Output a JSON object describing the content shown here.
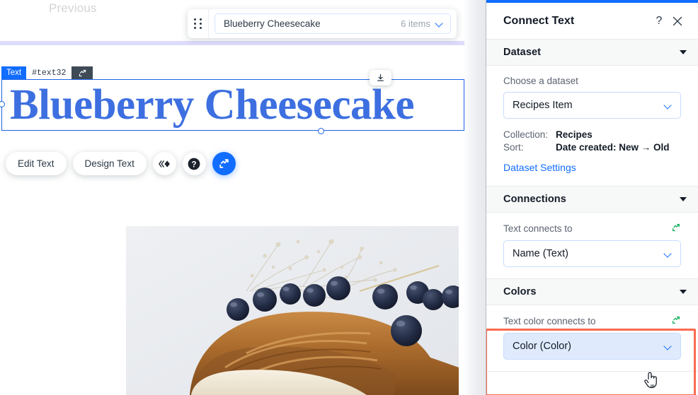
{
  "canvas": {
    "previous_label": "Previous",
    "item_bar": {
      "drag_handle_icon": "drag-dots-icon",
      "item_name": "Blueberry Cheesecake",
      "item_count": "6 items",
      "chevron_icon": "chevron-down-icon"
    },
    "selection": {
      "type_badge": "Text",
      "element_id": "#text32",
      "connect_icon": "connect-icon",
      "anchor_icon": "anchor-download-icon"
    },
    "headline": "Blueberry Cheesecake",
    "headline_color": "#3D6FE0",
    "toolbar": {
      "edit_text_label": "Edit Text",
      "design_text_label": "Design Text",
      "animation_icon": "animation-icon",
      "help_icon": "help-icon",
      "connect_icon": "connect-data-icon"
    },
    "photo_alt": "blueberry-cheesecake-photo"
  },
  "panel": {
    "accent_color": "#116DFF",
    "title": "Connect Text",
    "help_icon": "question-mark-icon",
    "close_icon": "close-icon",
    "sections": {
      "dataset": {
        "title": "Dataset",
        "collapse_icon": "triangle-down-icon",
        "choose_label": "Choose a dataset",
        "selected_dataset": "Recipes Item",
        "dropdown_icon": "chevron-down-icon",
        "collection_key": "Collection:",
        "collection_value": "Recipes",
        "sort_key": "Sort:",
        "sort_value": "Date created: New → Old",
        "settings_link": "Dataset Settings"
      },
      "connections": {
        "title": "Connections",
        "collapse_icon": "triangle-down-icon",
        "text_connects_label": "Text connects to",
        "sync_icon": "connect-green-icon",
        "text_connects_value": "Name (Text)",
        "dropdown_icon": "chevron-down-icon"
      },
      "colors": {
        "title": "Colors",
        "collapse_icon": "triangle-down-icon",
        "text_color_label": "Text color connects to",
        "sync_icon": "connect-green-icon",
        "text_color_value": "Color (Color)",
        "dropdown_icon": "chevron-down-icon",
        "highlight_color": "#FA6B4F"
      }
    }
  },
  "cursor": {
    "icon": "pointing-hand-cursor"
  }
}
